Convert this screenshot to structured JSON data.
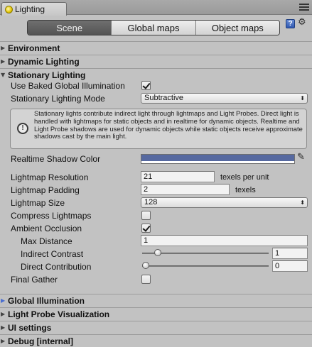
{
  "window": {
    "tab_title": "Lighting"
  },
  "modes": {
    "scene": "Scene",
    "global_maps": "Global maps",
    "object_maps": "Object maps",
    "active": "Scene"
  },
  "sections": {
    "environment": "Environment",
    "dynamic_lighting": "Dynamic Lighting",
    "stationary_lighting": "Stationary Lighting",
    "global_illumination": "Global Illumination",
    "light_probe_visualization": "Light Probe Visualization",
    "ui_settings": "UI settings",
    "debug": "Debug [internal]"
  },
  "stationary": {
    "use_baked_gi_label": "Use Baked Global Illumination",
    "use_baked_gi_checked": true,
    "mode_label": "Stationary Lighting Mode",
    "mode_value": "Subtractive",
    "info_text": "Stationary lights contribute indirect light through lightmaps and Light Probes. Direct light is handled with lightmaps for static objects and in realtime for dynamic objects. Realtime and Light Probe shadows are used for dynamic objects while static objects receive approximate shadows cast by the main light.",
    "shadow_color_label": "Realtime Shadow Color",
    "shadow_color": "#5669a0"
  },
  "lightmap": {
    "resolution_label": "Lightmap Resolution",
    "resolution_value": "21",
    "resolution_unit": "texels per unit",
    "padding_label": "Lightmap Padding",
    "padding_value": "2",
    "padding_unit": "texels",
    "size_label": "Lightmap Size",
    "size_value": "128",
    "compress_label": "Compress Lightmaps",
    "compress_checked": false,
    "ao_label": "Ambient Occlusion",
    "ao_checked": true,
    "max_distance_label": "Max Distance",
    "max_distance_value": "1",
    "indirect_contrast_label": "Indirect Contrast",
    "indirect_contrast_value": "1",
    "indirect_contrast_fraction": 0.1,
    "direct_contribution_label": "Direct Contribution",
    "direct_contribution_value": "0",
    "direct_contribution_fraction": 0.0,
    "final_gather_label": "Final Gather",
    "final_gather_checked": false
  },
  "icons": {
    "tab": "lighting-bulb-icon",
    "help": "help-book-icon",
    "gear": "gear-icon",
    "menu": "window-menu-icon",
    "info": "info-icon",
    "picker": "eyedropper-icon"
  }
}
